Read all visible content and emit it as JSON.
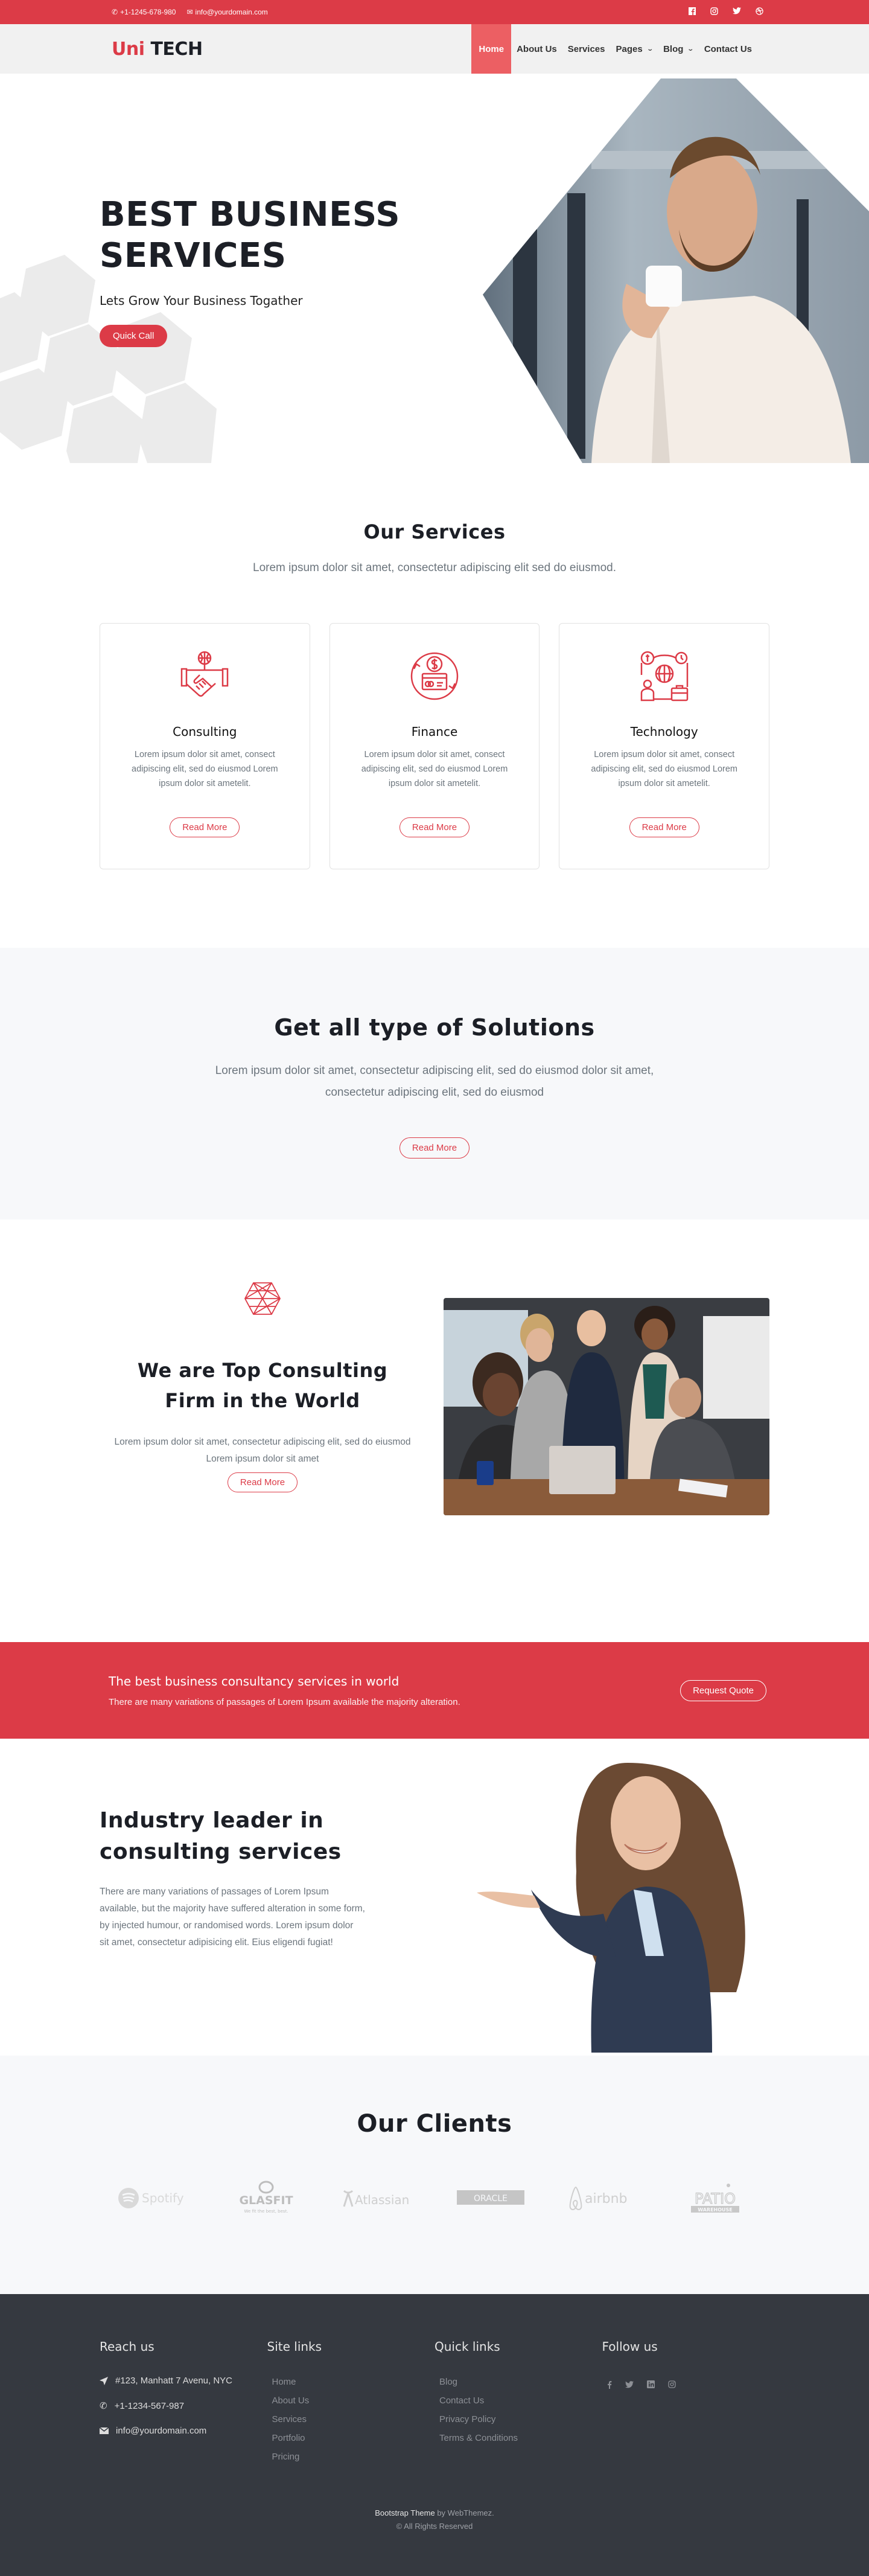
{
  "colors": {
    "accent": "#dc3b47",
    "nav_active": "#ec5f63",
    "dark": "#1c1f26",
    "footer_bg": "#353940",
    "light_bg": "#f7f8fa"
  },
  "topbar": {
    "phone": "+1-1245-678-980",
    "email": "info@yourdomain.com",
    "social": [
      "facebook-icon",
      "instagram-icon",
      "twitter-icon",
      "dribbble-icon"
    ]
  },
  "navbar": {
    "logo_part1": "Uni",
    "logo_part2": "TECH",
    "items": [
      {
        "label": "Home",
        "active": true
      },
      {
        "label": "About Us"
      },
      {
        "label": "Services"
      },
      {
        "label": "Pages",
        "dropdown": true
      },
      {
        "label": "Blog",
        "dropdown": true
      },
      {
        "label": "Contact Us"
      }
    ]
  },
  "hero": {
    "title_line1": "BEST BUSINESS",
    "title_line2": "SERVICES",
    "subtitle": "Lets Grow Your Business Togather",
    "button": "Quick Call"
  },
  "services": {
    "title": "Our Services",
    "lead": "Lorem ipsum dolor sit amet, consectetur adipiscing elit sed do eiusmod.",
    "cards": [
      {
        "icon": "handshake-globe-icon",
        "title": "Consulting",
        "text": "Lorem ipsum dolor sit amet, consect adipiscing elit, sed do eiusmod Lorem ipsum dolor sit ametelit.",
        "button": "Read More"
      },
      {
        "icon": "finance-card-icon",
        "title": "Finance",
        "text": "Lorem ipsum dolor sit amet, consect adipiscing elit, sed do eiusmod Lorem ipsum dolor sit ametelit.",
        "button": "Read More"
      },
      {
        "icon": "technology-network-icon",
        "title": "Technology",
        "text": "Lorem ipsum dolor sit amet, consect adipiscing elit, sed do eiusmod Lorem ipsum dolor sit ametelit.",
        "button": "Read More"
      }
    ]
  },
  "solutions": {
    "title": "Get all type of Solutions",
    "text": "Lorem ipsum dolor sit amet, consectetur adipiscing elit, sed do eiusmod dolor sit amet, consectetur adipiscing elit, sed do eiusmod",
    "button": "Read More"
  },
  "about": {
    "title_line1": "We are Top Consulting",
    "title_line2": "Firm in the World",
    "text": "Lorem ipsum dolor sit amet, consectetur adipiscing elit, sed do eiusmod Lorem ipsum dolor sit amet",
    "button": "Read More"
  },
  "cta": {
    "title": "The best business consultancy services in world",
    "text": "There are many variations of passages of Lorem Ipsum available the majority alteration.",
    "button": "Request Quote"
  },
  "industry": {
    "title_line1": "Industry leader in",
    "title_line2": "consulting services",
    "text": "There are many variations of passages of Lorem Ipsum available, but the majority have suffered alteration in some form, by injected humour, or randomised words. Lorem ipsum dolor sit amet, consectetur adipisicing elit. Eius eligendi fugiat!"
  },
  "clients": {
    "title": "Our Clients",
    "logos": [
      "Spotify",
      "GLASFIT",
      "Atlassian",
      "ORACLE",
      "airbnb",
      "PATIO"
    ],
    "glasfit_tagline": "We fit the best, best.",
    "patio_tagline": "WAREHOUSE"
  },
  "footer": {
    "reach": {
      "title": "Reach us",
      "address": "#123, Manhatt 7 Avenu, NYC",
      "phone": "+1-1234-567-987",
      "email": "info@yourdomain.com"
    },
    "site_links": {
      "title": "Site links",
      "items": [
        "Home",
        "About Us",
        "Services",
        "Portfolio",
        "Pricing"
      ]
    },
    "quick_links": {
      "title": "Quick links",
      "items": [
        "Blog",
        "Contact Us",
        "Privacy Policy",
        "Terms & Conditions"
      ]
    },
    "follow": {
      "title": "Follow us",
      "icons": [
        "facebook-icon",
        "twitter-icon",
        "linkedin-icon",
        "instagram-icon"
      ]
    },
    "credit_strong": "Bootstrap Theme",
    "credit_rest": " by WebThemez.",
    "rights": "© All Rights Reserved"
  }
}
